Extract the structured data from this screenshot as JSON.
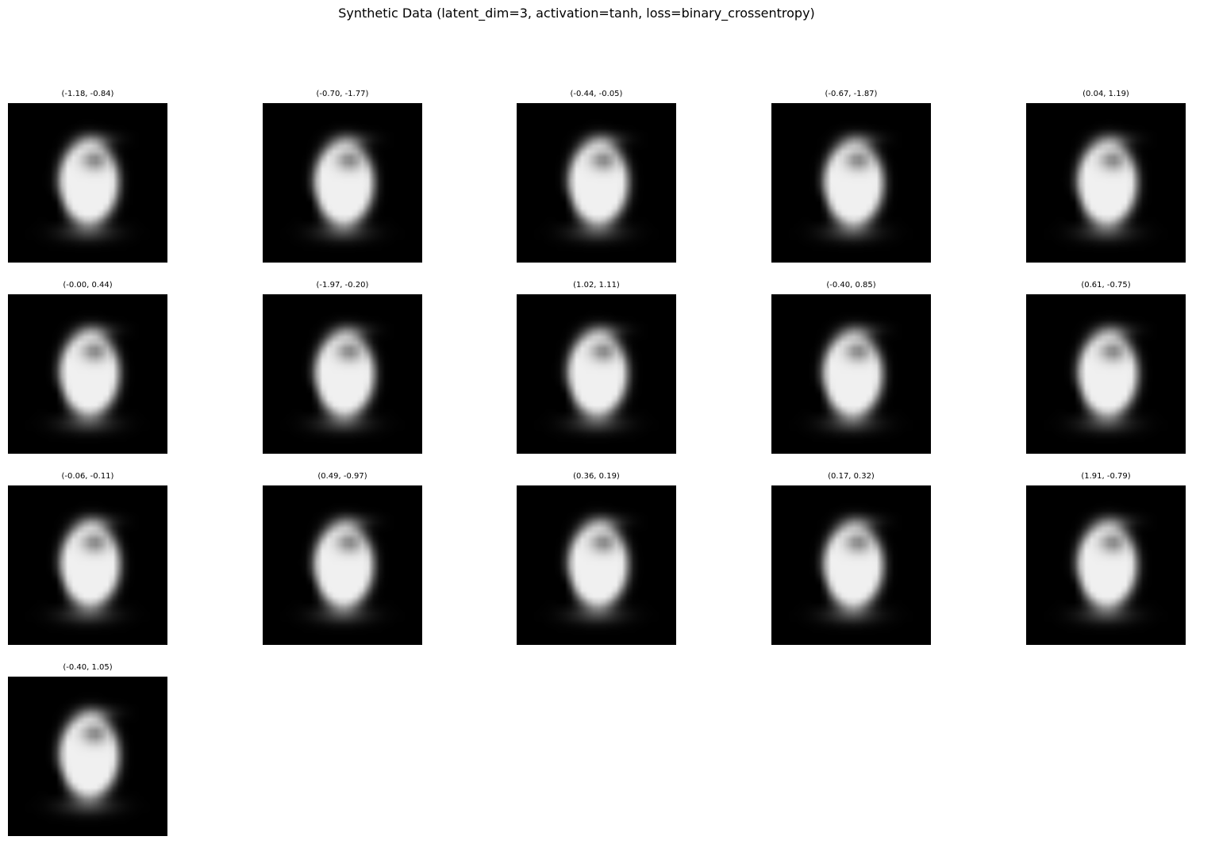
{
  "figure": {
    "title": "Synthetic Data (latent_dim=3, activation=tanh, loss=binary_crossentropy)"
  },
  "panels": [
    {
      "title": "(-1.18, -0.84)"
    },
    {
      "title": "(-0.70, -1.77)"
    },
    {
      "title": "(-0.44, -0.05)"
    },
    {
      "title": "(-0.67, -1.87)"
    },
    {
      "title": "(0.04, 1.19)"
    },
    {
      "title": "(-0.00, 0.44)"
    },
    {
      "title": "(-1.97, -0.20)"
    },
    {
      "title": "(1.02, 1.11)"
    },
    {
      "title": "(-0.40, 0.85)"
    },
    {
      "title": "(0.61, -0.75)"
    },
    {
      "title": "(-0.06, -0.11)"
    },
    {
      "title": "(0.49, -0.97)"
    },
    {
      "title": "(0.36, 0.19)"
    },
    {
      "title": "(0.17, 0.32)"
    },
    {
      "title": "(1.91, -0.79)"
    },
    {
      "title": "(-0.40, 1.05)"
    }
  ],
  "image": {
    "colormap": "gray",
    "grid_size": "28x28",
    "background_color": "#000000",
    "foreground_color": "#ffffff"
  }
}
